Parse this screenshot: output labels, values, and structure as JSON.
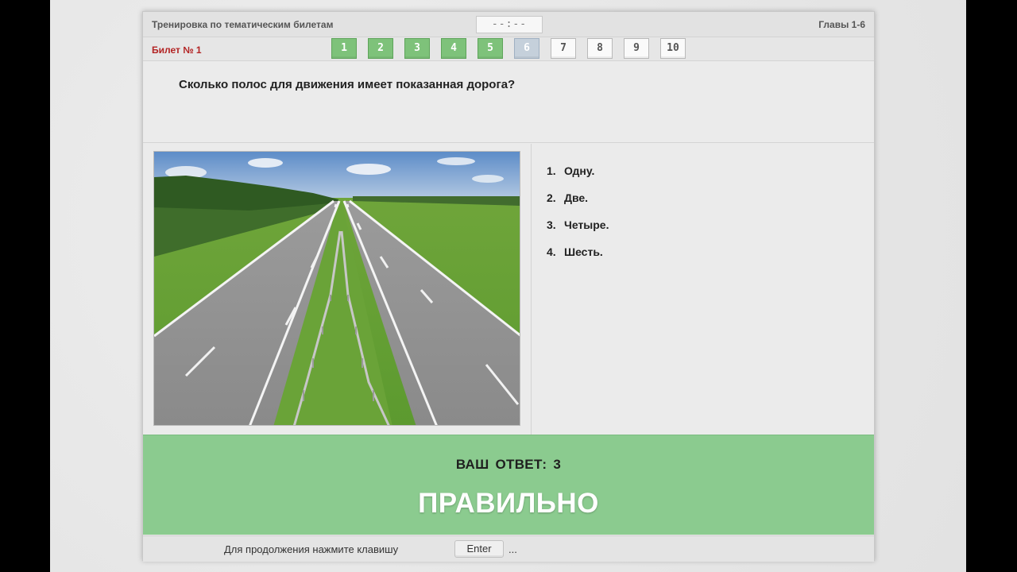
{
  "header": {
    "title": "Тренировка по тематическим билетам",
    "timer": "--:--",
    "chapters": "Главы 1-6"
  },
  "ticket": {
    "label": "Билет № 1",
    "questions": [
      {
        "label": "1",
        "state": "answered"
      },
      {
        "label": "2",
        "state": "answered"
      },
      {
        "label": "3",
        "state": "answered"
      },
      {
        "label": "4",
        "state": "answered"
      },
      {
        "label": "5",
        "state": "answered"
      },
      {
        "label": "6",
        "state": "current"
      },
      {
        "label": "7",
        "state": "pending"
      },
      {
        "label": "8",
        "state": "pending"
      },
      {
        "label": "9",
        "state": "pending"
      },
      {
        "label": "10",
        "state": "pending"
      }
    ]
  },
  "question": {
    "text": "Сколько полос для движения имеет показанная дорога?",
    "image": "divided-highway-photo",
    "answers": [
      {
        "num": "1.",
        "text": "Одну."
      },
      {
        "num": "2.",
        "text": "Две."
      },
      {
        "num": "3.",
        "text": "Четыре."
      },
      {
        "num": "4.",
        "text": "Шесть."
      }
    ]
  },
  "result": {
    "your_answer_label": "ВАШ ОТВЕТ:",
    "your_answer_value": "3",
    "verdict": "ПРАВИЛЬНО"
  },
  "footer": {
    "prompt": "Для продолжения нажмите клавишу",
    "key": "Enter",
    "ellipsis": "..."
  },
  "colors": {
    "answered": "#7ec27a",
    "current": "#c5d0db",
    "result_bg": "#8bcb8f",
    "ticket_label": "#b32424"
  }
}
